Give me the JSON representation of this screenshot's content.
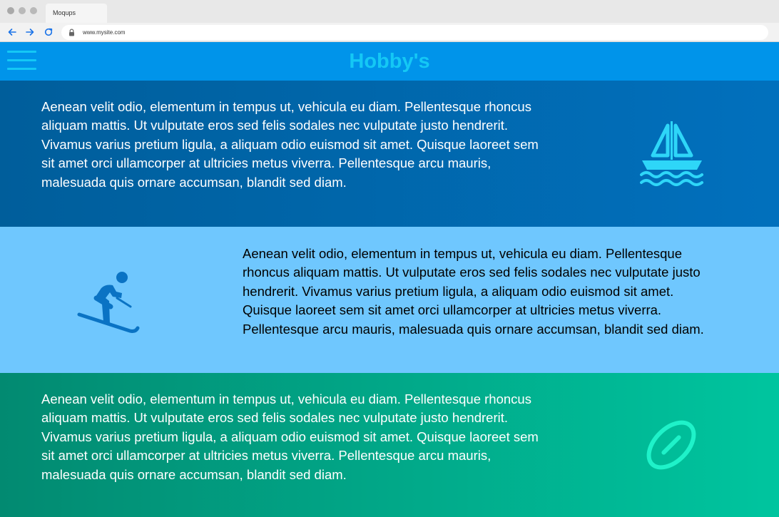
{
  "browser": {
    "tab_title": "Moqups",
    "url": "www.mysite.com"
  },
  "header": {
    "title": "Hobby's"
  },
  "sections": [
    {
      "text": "Aenean velit odio, elementum in tempus ut, vehicula eu diam. Pellentesque rhoncus aliquam mattis. Ut vulputate eros sed felis sodales nec vulputate justo hendrerit. Vivamus varius pretium ligula, a aliquam odio euismod sit amet. Quisque laoreet sem sit amet orci ullamcorper at ultricies metus viverra. Pellentesque arcu mauris, malesuada quis  ornare accumsan, blandit sed diam.",
      "icon": "sailboat-icon"
    },
    {
      "text": "Aenean velit odio, elementum in tempus ut, vehicula eu diam. Pellentesque rhoncus aliquam mattis. Ut vulputate eros sed felis sodales nec vulputate justo hendrerit. Vivamus varius pretium ligula, a aliquam odio euismod sit amet. Quisque laoreet sem sit amet orci ullamcorper at ultricies metus viverra. Pellentesque arcu mauris, malesuada quis ornare accumsan, blandit sed diam.",
      "icon": "skiing-icon"
    },
    {
      "text": "Aenean velit odio, elementum in tempus ut, vehicula eu diam. Pellentesque rhoncus aliquam mattis. Ut vulputate eros sed felis sodales nec vulputate justo hendrerit. Vivamus varius pretium ligula, a aliquam odio euismod sit amet. Quisque laoreet sem sit amet orci ullamcorper at ultricies metus viverra. Pellentesque arcu mauris, malesuada quis  ornare accumsan, blandit sed diam.",
      "icon": "football-icon"
    }
  ],
  "colors": {
    "header_bg": "#0094ea",
    "accent": "#14c8f5",
    "section1_bg": "#0069ad",
    "section2_bg": "#6fc7fe",
    "section3_bg": "#00a78a",
    "ski_icon": "#0a73c4",
    "football_icon": "#1ff2c9"
  }
}
